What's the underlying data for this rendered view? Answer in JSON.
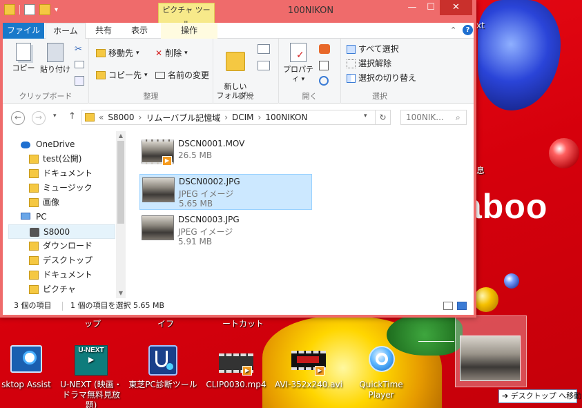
{
  "window": {
    "title": "100NIKON",
    "contextual_tab": "ピクチャ ツール",
    "controls": {
      "minimize": "—",
      "maximize": "☐",
      "close": "✕"
    }
  },
  "ribbon": {
    "tabs": [
      "ファイル",
      "ホーム",
      "共有",
      "表示",
      "操作"
    ],
    "groups": {
      "clipboard": {
        "label": "クリップボード",
        "copy": "コピー",
        "paste": "貼り付け"
      },
      "organize": {
        "label": "整理",
        "move_to": "移動先",
        "copy_to": "コピー先",
        "delete": "削除",
        "rename": "名前の変更"
      },
      "new": {
        "label": "新規",
        "new_folder": "新しい\nフォルダー"
      },
      "open": {
        "label": "開く",
        "properties": "プロパティ"
      },
      "select": {
        "label": "選択",
        "select_all": "すべて選択",
        "select_none": "選択解除",
        "invert": "選択の切り替え"
      }
    }
  },
  "address": {
    "breadcrumb": [
      "«",
      "S8000",
      "›",
      "リムーバブル記憶域",
      "›",
      "DCIM",
      "›",
      "100NIKON"
    ],
    "search_placeholder": "100NIK..."
  },
  "nav_pane": {
    "items": [
      {
        "label": "OneDrive",
        "icon": "cloud-icon"
      },
      {
        "label": "test(公開)",
        "icon": "folder-icon"
      },
      {
        "label": "ドキュメント",
        "icon": "folder-icon"
      },
      {
        "label": "ミュージック",
        "icon": "folder-icon"
      },
      {
        "label": "画像",
        "icon": "folder-icon"
      },
      {
        "label": "PC",
        "icon": "pc-icon"
      },
      {
        "label": "S8000",
        "icon": "camera-icon"
      },
      {
        "label": "ダウンロード",
        "icon": "download-folder-icon"
      },
      {
        "label": "デスクトップ",
        "icon": "desktop-folder-icon"
      },
      {
        "label": "ドキュメント",
        "icon": "documents-folder-icon"
      },
      {
        "label": "ピクチャ",
        "icon": "pictures-folder-icon"
      }
    ]
  },
  "files": [
    {
      "name": "DSCN0001.MOV",
      "type": "",
      "size": "26.5 MB",
      "selected": false
    },
    {
      "name": "DSCN0002.JPG",
      "type": "JPEG イメージ",
      "size": "5.65 MB",
      "selected": true
    },
    {
      "name": "DSCN0003.JPG",
      "type": "JPEG イメージ",
      "size": "5.91 MB",
      "selected": false
    }
  ],
  "status": {
    "count": "3 個の項目",
    "selection": "1 個の項目を選択  5.65 MB"
  },
  "desktop": {
    "brand_text": "aboo",
    "fragments": [
      "xt",
      "ップ",
      "イフ",
      "ートカット",
      "息"
    ],
    "icons": [
      {
        "label": "sktop Assist"
      },
      {
        "label": "U-NEXT (映画・ドラマ無料見放題)"
      },
      {
        "label": "東芝PC診断ツール"
      },
      {
        "label": "CLIP0030.mp4"
      },
      {
        "label": "AVI-352x240.avi"
      },
      {
        "label": "QuickTime Player"
      }
    ],
    "move_to_desktop": "➔ デスクトップ へ移動"
  },
  "colors": {
    "title_bar": "#ef6b6b",
    "file_tab": "#1979ca",
    "selection": "#cce8ff",
    "desktop": "#d6000c"
  }
}
